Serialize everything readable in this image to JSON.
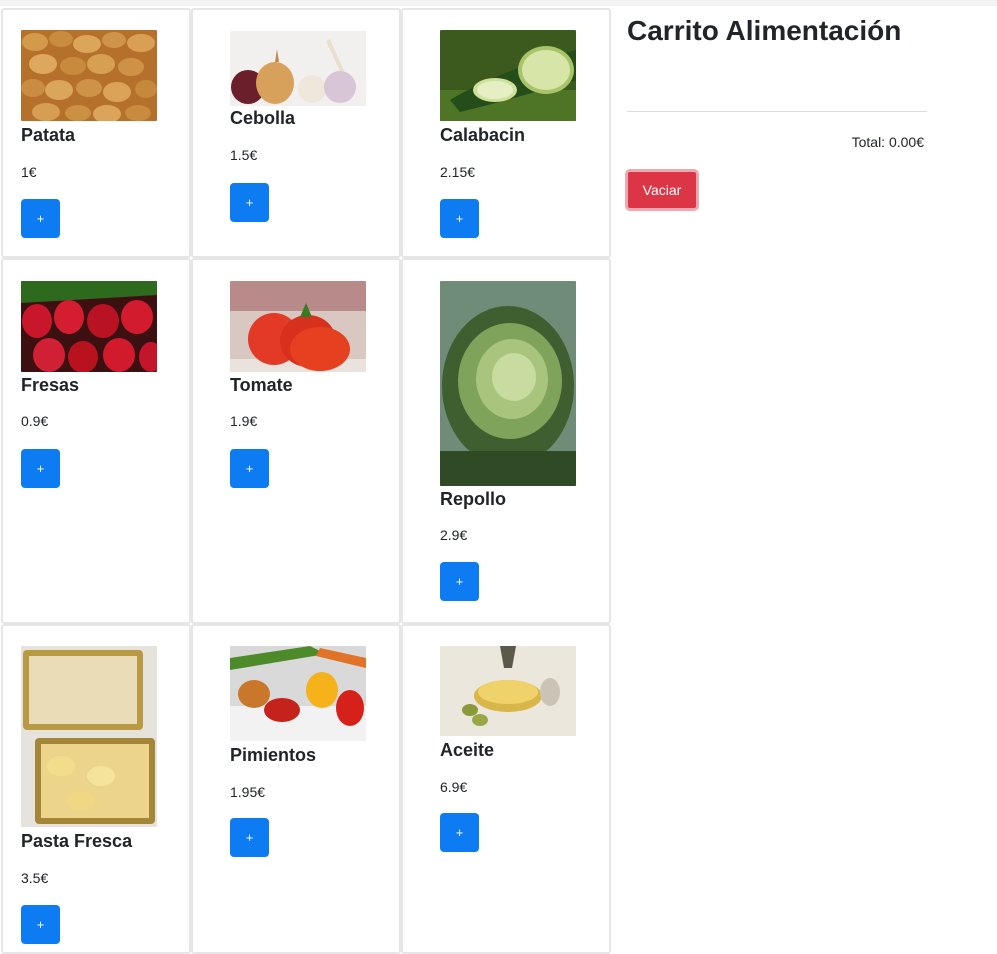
{
  "products": [
    {
      "name": "Patata",
      "price": "1€",
      "add_label": "+"
    },
    {
      "name": "Cebolla",
      "price": "1.5€",
      "add_label": "+"
    },
    {
      "name": "Calabacin",
      "price": "2.15€",
      "add_label": "+"
    },
    {
      "name": "Fresas",
      "price": "0.9€",
      "add_label": "+"
    },
    {
      "name": "Tomate",
      "price": "1.9€",
      "add_label": "+"
    },
    {
      "name": "Repollo",
      "price": "2.9€",
      "add_label": "+"
    },
    {
      "name": "Pasta Fresca",
      "price": "3.5€",
      "add_label": "+"
    },
    {
      "name": "Pimientos",
      "price": "1.95€",
      "add_label": "+"
    },
    {
      "name": "Aceite",
      "price": "6.9€",
      "add_label": "+"
    }
  ],
  "cart": {
    "title": "Carrito Alimentación",
    "total": "Total: 0.00€",
    "clear_label": "Vaciar"
  },
  "colors": {
    "add_button": "#0d7cf2",
    "clear_button": "#dc3545"
  }
}
